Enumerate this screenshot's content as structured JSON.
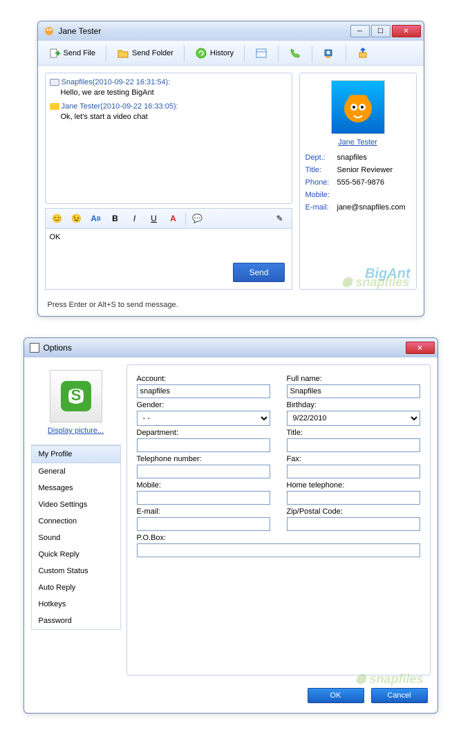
{
  "chat_window": {
    "title": "Jane Tester",
    "toolbar": {
      "send_file": "Send File",
      "send_folder": "Send Folder",
      "history": "History"
    },
    "messages": [
      {
        "header": "Snapfiles(2010-09-22 16:31:54):",
        "body": "Hello, we are testing BigAnt",
        "dir": "out"
      },
      {
        "header": "Jane Tester(2010-09-22 16:33:05):",
        "body": "Ok, let's start a video chat",
        "dir": "in"
      }
    ],
    "input_text": "OK",
    "send_label": "Send",
    "status": "Press Enter or Alt+S to send message.",
    "contact": {
      "name": "Jane Tester",
      "dept_label": "Dept.:",
      "dept": "snapfiles",
      "title_label": "Title:",
      "title": "Senior Reviewer",
      "phone_label": "Phone:",
      "phone": "555-567-9876",
      "mobile_label": "Mobile:",
      "mobile": "",
      "email_label": "E-mail:",
      "email": "jane@snapfiles.com"
    },
    "brand": "BigAnt"
  },
  "options_window": {
    "title": "Options",
    "display_picture_link": "Display picture...",
    "nav": [
      "My Profile",
      "General",
      "Messages",
      "Video Settings",
      "Connection",
      "Sound",
      "Quick Reply",
      "Custom Status",
      "Auto Reply",
      "Hotkeys",
      "Password"
    ],
    "form": {
      "account_label": "Account:",
      "account": "snapfiles",
      "fullname_label": "Full name:",
      "fullname": "Snapfiles",
      "gender_label": "Gender:",
      "gender": "- -",
      "birthday_label": "Birthday:",
      "birthday": "9/22/2010",
      "department_label": "Department:",
      "department": "",
      "title_label": "Title:",
      "title": "",
      "telephone_label": "Telephone number:",
      "telephone": "",
      "fax_label": "Fax:",
      "fax": "",
      "mobile_label": "Mobile:",
      "mobile": "",
      "home_tel_label": "Home telephone:",
      "home_tel": "",
      "email_label": "E-mail:",
      "email": "",
      "zip_label": "Zip/Postal Code:",
      "zip": "",
      "pobox_label": "P.O.Box:",
      "pobox": ""
    },
    "buttons": {
      "ok": "OK",
      "cancel": "Cancel"
    }
  }
}
